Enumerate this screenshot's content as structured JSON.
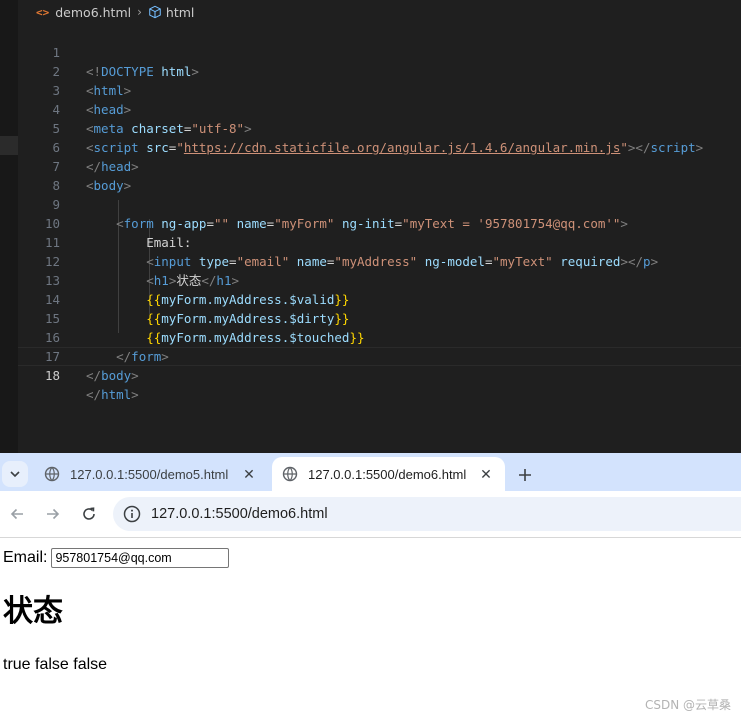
{
  "editor": {
    "breadcrumb": {
      "file": "demo6.html",
      "separator": "›",
      "element": "html",
      "file_icon": "html-file-icon",
      "element_icon": "cube-icon"
    },
    "current_line": 18,
    "lines": [
      {
        "n": "1"
      },
      {
        "n": "2"
      },
      {
        "n": "3"
      },
      {
        "n": "4"
      },
      {
        "n": "5"
      },
      {
        "n": "6"
      },
      {
        "n": "7"
      },
      {
        "n": "8"
      },
      {
        "n": "9"
      },
      {
        "n": "10"
      },
      {
        "n": "11"
      },
      {
        "n": "12"
      },
      {
        "n": "13"
      },
      {
        "n": "14"
      },
      {
        "n": "15"
      },
      {
        "n": "16"
      },
      {
        "n": "17"
      },
      {
        "n": "18"
      }
    ],
    "tokens": {
      "doctype": "DOCTYPE",
      "html": "html",
      "head": "head",
      "meta": "meta",
      "charset": "charset",
      "utf8": "\"utf-8\"",
      "script": "script",
      "src": "src",
      "angular_url": "https://cdn.staticfile.org/angular.js/1.4.6/angular.min.js",
      "body": "body",
      "form": "form",
      "ng_app": "ng-app",
      "empty": "\"\"",
      "name": "name",
      "my_form": "\"myForm\"",
      "ng_init": "ng-init",
      "init_value": "\"myText = '957801754@qq.com'\"",
      "email_label": "Email:",
      "input": "input",
      "type": "type",
      "email_type": "\"email\"",
      "my_address": "\"myAddress\"",
      "ng_model": "ng-model",
      "my_text": "\"myText\"",
      "required": "required",
      "p": "p",
      "h1": "h1",
      "h1_text": "状态",
      "expr_valid": "myForm.myAddress.$valid",
      "expr_dirty": "myForm.myAddress.$dirty",
      "expr_touched": "myForm.myAddress.$touched"
    }
  },
  "browser": {
    "tabs": [
      {
        "title": "127.0.0.1:5500/demo5.html",
        "active": false
      },
      {
        "title": "127.0.0.1:5500/demo6.html",
        "active": true
      }
    ],
    "address": "127.0.0.1:5500/demo6.html",
    "page": {
      "email_label": "Email:",
      "email_value": "957801754@qq.com",
      "heading": "状态",
      "status": "true false false"
    }
  },
  "watermark": "CSDN @云草桑",
  "colors": {
    "editor_bg": "#1f1f1f",
    "tag": "#569cd6",
    "attribute": "#9cdcfe",
    "string": "#ce9178",
    "bracket": "#808080",
    "mustache": "#ffd700",
    "tab_strip": "#d3e3fd",
    "omnibox": "#edf2fa"
  }
}
